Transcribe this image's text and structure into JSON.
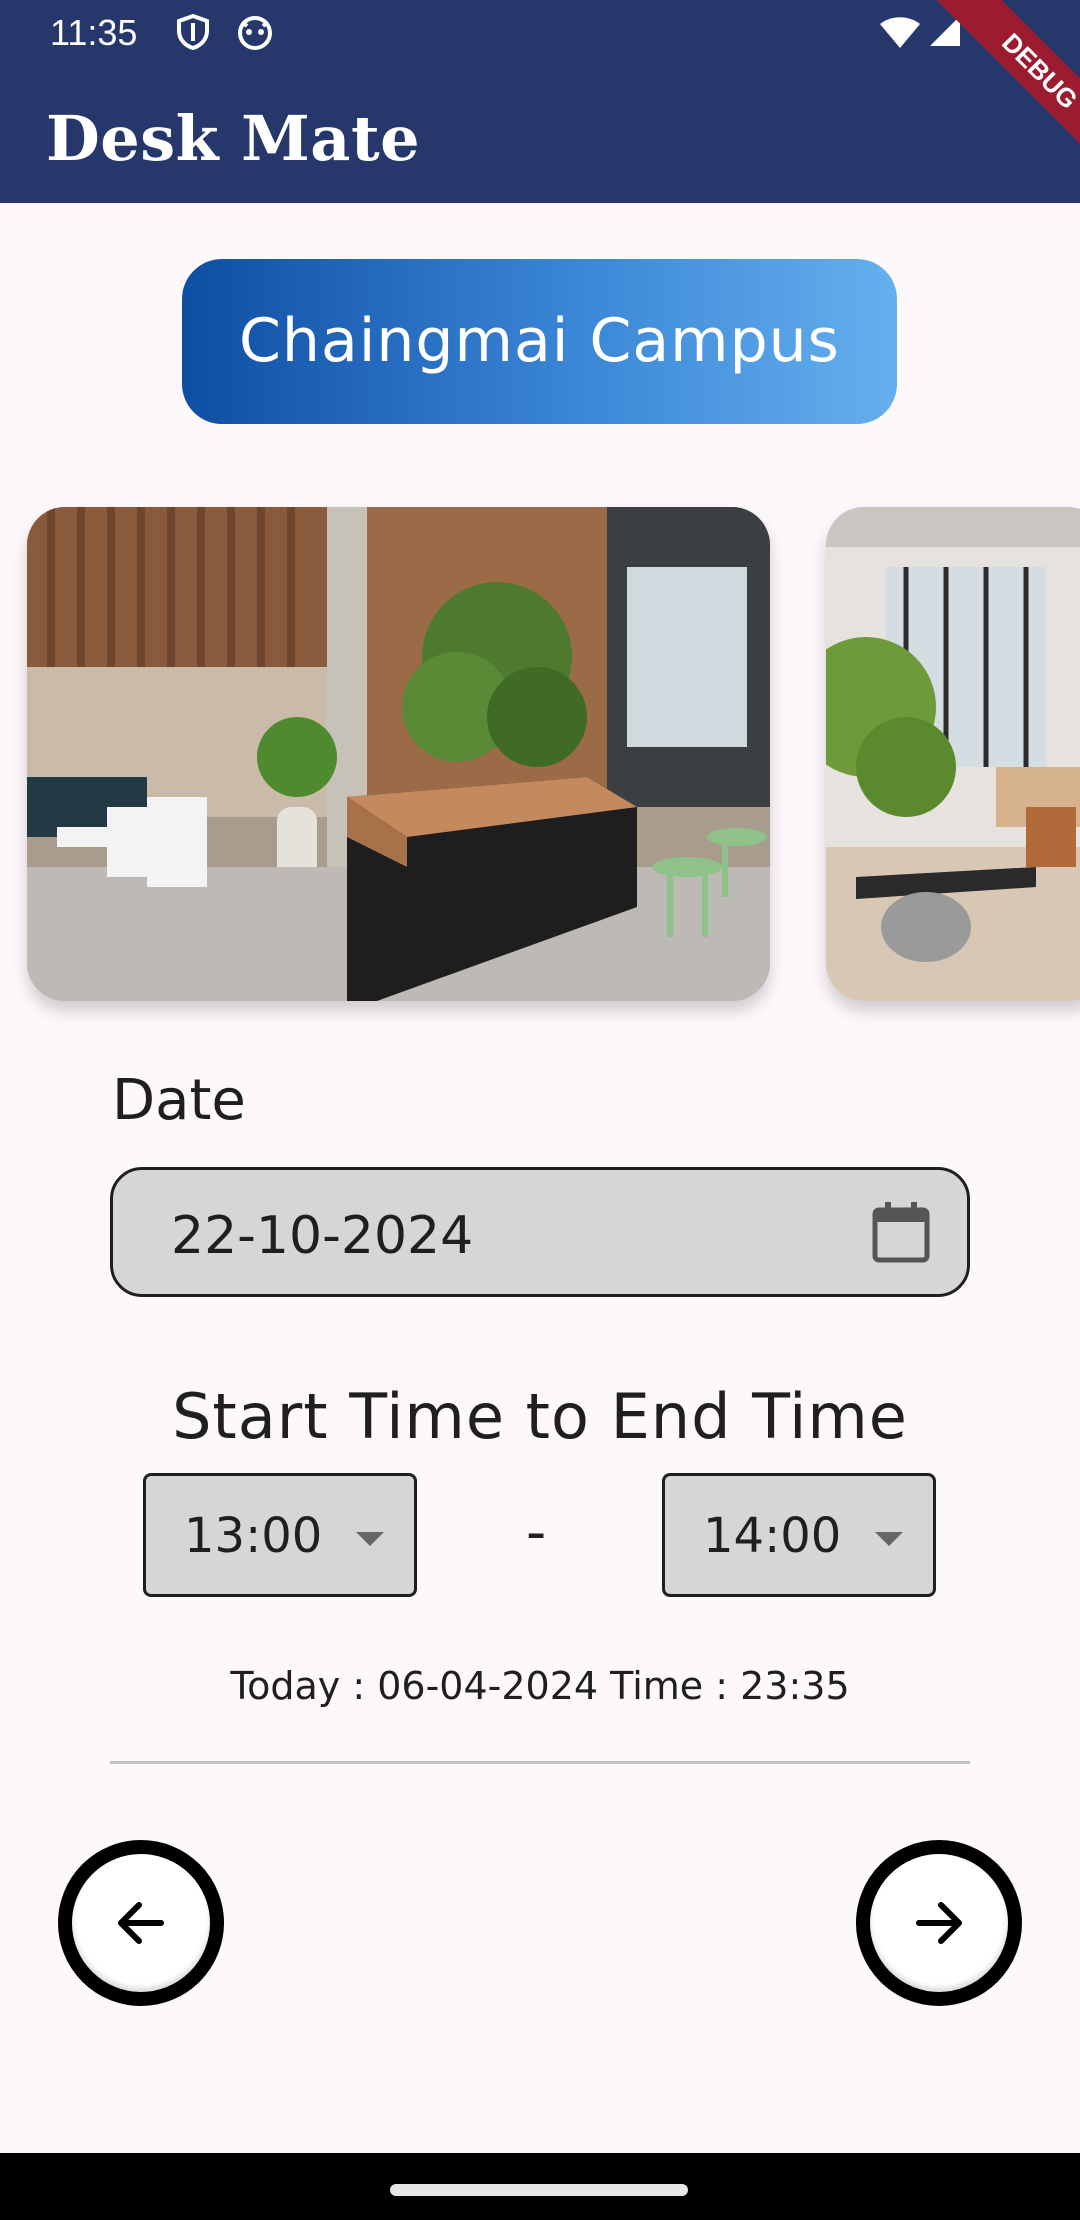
{
  "status_bar": {
    "time": "11:35",
    "icons": [
      "shield-icon",
      "robot-face-icon",
      "wifi-icon",
      "cell-signal-icon"
    ]
  },
  "app_bar": {
    "title": "Desk Mate",
    "debug_banner": "DEBUG",
    "color": "#26386b"
  },
  "campus": {
    "name": "Chaingmai Campus"
  },
  "gallery": {
    "images": [
      "coworking-lobby-photo",
      "coworking-lounge-photo"
    ]
  },
  "date": {
    "label": "Date",
    "value": "22-10-2024"
  },
  "time_range": {
    "heading": "Start Time to End Time",
    "start": "13:00",
    "separator": "-",
    "end": "14:00"
  },
  "today": {
    "text": "Today : 06-04-2024 Time : 23:35"
  },
  "navigation": {
    "back_icon": "arrow-left-icon",
    "next_icon": "arrow-right-icon"
  }
}
